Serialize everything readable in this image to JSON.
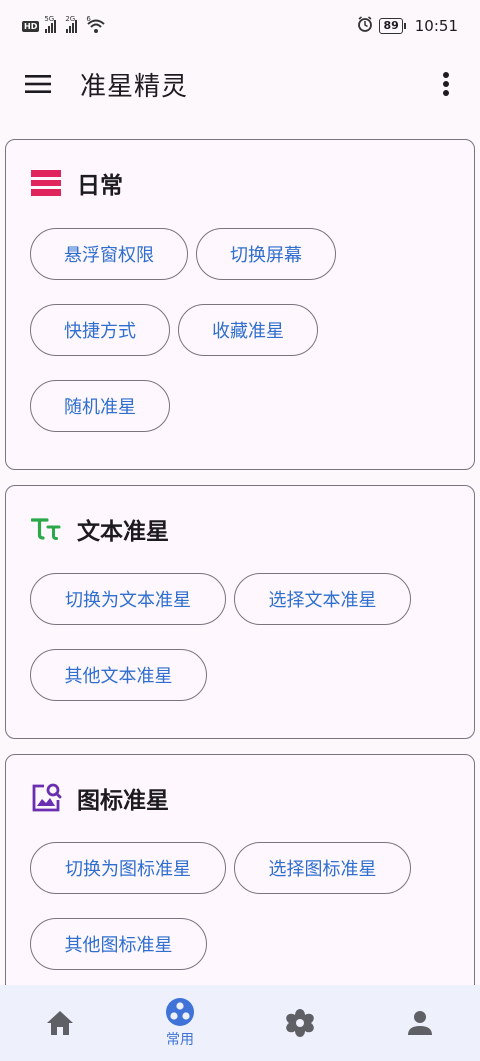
{
  "status_bar": {
    "hd": "HD",
    "signal1_label": "5G",
    "signal2_label": "2G",
    "wifi_label": "6",
    "battery": "89",
    "time": "10:51"
  },
  "app_bar": {
    "title": "准星精灵"
  },
  "colors": {
    "accent": "#2f6fcf",
    "outline": "#79747e",
    "daily_icon": "#e0245e",
    "text_icon": "#2aa84a",
    "image_icon": "#6a2fb0",
    "nav_active": "#3f73d8",
    "nav_bg": "#eef0fb"
  },
  "cards": [
    {
      "title": "日常",
      "icon": "list-icon",
      "chips": [
        "悬浮窗权限",
        "切换屏幕",
        "快捷方式",
        "收藏准星",
        "随机准星"
      ]
    },
    {
      "title": "文本准星",
      "icon": "text-format-icon",
      "chips": [
        "切换为文本准星",
        "选择文本准星",
        "其他文本准星"
      ]
    },
    {
      "title": "图标准星",
      "icon": "image-search-icon",
      "chips": [
        "切换为图标准星",
        "选择图标准星",
        "其他图标准星"
      ]
    }
  ],
  "bottom_nav": {
    "items": [
      {
        "icon": "home-icon",
        "label": ""
      },
      {
        "icon": "common-icon",
        "label": "常用",
        "active": true
      },
      {
        "icon": "settings-flower-icon",
        "label": ""
      },
      {
        "icon": "person-icon",
        "label": ""
      }
    ]
  }
}
